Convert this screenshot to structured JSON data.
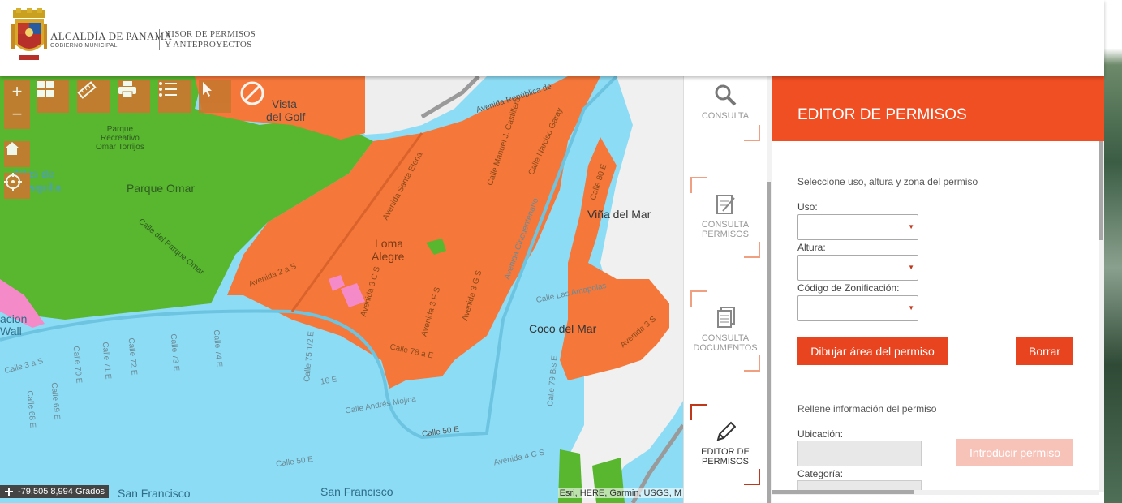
{
  "header": {
    "org_name": "ALCALDÍA DE PANAMÁ",
    "org_sub": "GOBIERNO MUNICIPAL",
    "app_line1": "VISOR DE PERMISOS",
    "app_line2": "Y ANTEPROYECTOS"
  },
  "map": {
    "labels": {
      "vista_golf_1": "Vista",
      "vista_golf_2": "del Golf",
      "parque_omar": "Parque Omar",
      "parque_recreativo": "Parque\nRecreativo\nOmar Torrijos",
      "altos_1": "Altos de",
      "altos_2": "asquilla",
      "loma_alegre_1": "Loma",
      "loma_alegre_2": "Alegre",
      "vina_del_mar": "Viña del Mar",
      "coco_del_mar": "Coco del Mar",
      "san_francisco_1": "San Francisco",
      "san_francisco_2": "San Francisco",
      "acion": "acion",
      "wall": "Wall"
    },
    "streets": {
      "av_republica": "Avenida República de",
      "av_santa_elena": "Avenida Santa Elena",
      "calle_manuel": "Calle Manuel J. Castillero",
      "calle_narciso": "Calle Narciso Garay",
      "calle_80": "Calle 80 E",
      "av_cincuentenario": "Avenida Cincuentenario",
      "calle_parque_omar": "Calle del Parque Omar",
      "av_2a_s": "Avenida 2 a S",
      "av_3c_s": "Avenida 3 C S",
      "av_3f_s": "Avenida 3 F S",
      "av_3g_s": "Avenida 3 G S",
      "calle_amapolas": "Calle Las Amapolas",
      "calle_78a": "Calle 78 a E",
      "av_3s": "Avenida 3 S",
      "calle_79b": "Calle 79 Bis E",
      "calle_andres": "Calle Andrés Mojica",
      "calle_50e_a": "Calle 50 E",
      "calle_50e_b": "Calle 50 E",
      "av_4cs": "Avenida 4 C S",
      "calle_3a": "Calle 3 a S",
      "calle_70": "Calle 70 E",
      "calle_71": "Calle 71 E",
      "calle_72": "Calle 72 E",
      "calle_73": "Calle 73 E",
      "calle_74": "Calle 74 E",
      "calle_75": "Calle 75 1/2 E",
      "calle_16": "16 E",
      "calle_69": "Calle 69 E",
      "calle_68": "Calle 68 E"
    },
    "zoom_in": "+",
    "zoom_out": "−",
    "coordinates": "-79,505 8,994 Grados",
    "attribution": "Esri, HERE, Garmin, USGS, M"
  },
  "nav": {
    "items": [
      {
        "label": "CONSULTA"
      },
      {
        "label": "CONSULTA\nPERMISOS"
      },
      {
        "label": "CONSULTA\nDOCUMENTOS"
      },
      {
        "label": "EDITOR DE\nPERMISOS"
      }
    ]
  },
  "panel": {
    "title": "EDITOR DE PERMISOS",
    "section1": "Seleccione uso, altura y zona del permiso",
    "uso_label": "Uso:",
    "altura_label": "Altura:",
    "codigo_label": "Código de Zonificación:",
    "draw_button": "Dibujar área del permiso",
    "clear_button": "Borrar",
    "section2": "Rellene información del permiso",
    "ubicacion_label": "Ubicación:",
    "introducir_button": "Introducir permiso",
    "categoria_label": "Categoría:"
  },
  "colors": {
    "accent": "#f04e23",
    "zone_orange": "#f5773a",
    "zone_green": "#58b62f",
    "zone_blue": "#8ddcf5",
    "zone_pink": "#f58ac8",
    "tool_bg": "#c97830"
  }
}
